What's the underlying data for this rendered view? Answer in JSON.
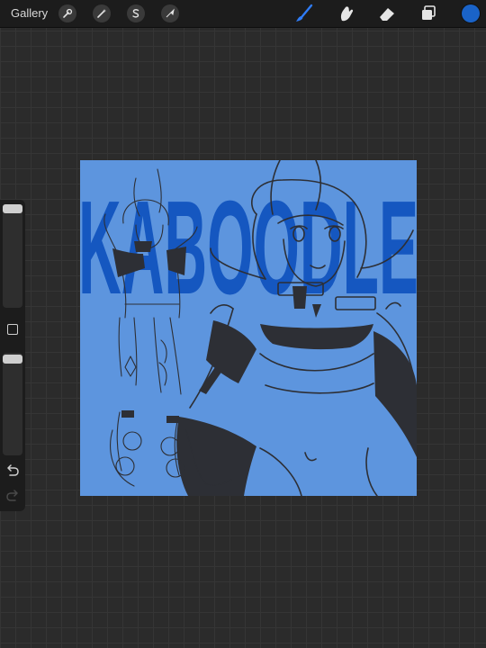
{
  "topbar": {
    "gallery_label": "Gallery",
    "left_tools": [
      "wrench-icon",
      "magic-wand-icon",
      "selection-icon",
      "transform-arrow-icon"
    ],
    "right_tools": [
      "brush-icon",
      "smudge-icon",
      "eraser-icon",
      "layers-icon"
    ],
    "active_color": "#1a63c8"
  },
  "sidebar": {
    "top_slider": "brush-size",
    "bottom_slider": "opacity",
    "buttons": [
      "modify-button",
      "undo-icon",
      "redo-icon"
    ]
  },
  "canvas": {
    "artwork_text": "KABOODLE",
    "colors": {
      "background": "#5d95de",
      "title": "#1557c0",
      "line": "#2d2f35"
    }
  }
}
